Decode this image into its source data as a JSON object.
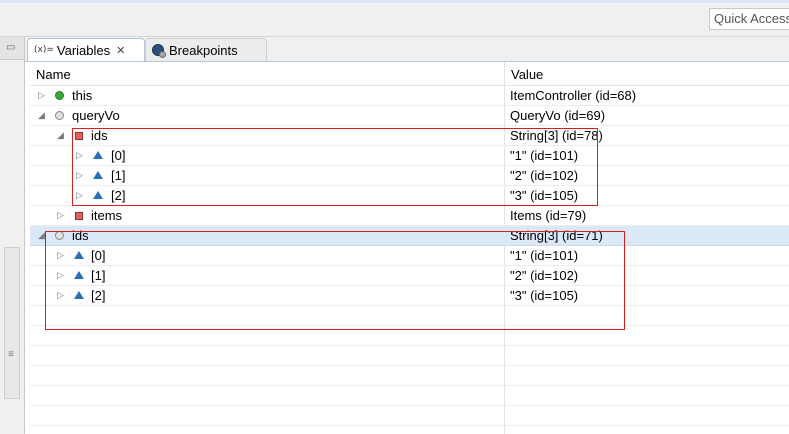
{
  "toolbar": {
    "quick_access": "Quick Access"
  },
  "tabs": [
    {
      "label": "Variables",
      "prefix": "(x)=",
      "close": "✕",
      "active": true
    },
    {
      "label": "Breakpoints",
      "active": false
    }
  ],
  "columns": {
    "name": "Name",
    "value": "Value"
  },
  "rows": [
    {
      "name": "this",
      "value": "ItemController  (id=68)",
      "icon": "green-circle",
      "expand": "collapsed",
      "depth": 0
    },
    {
      "name": "queryVo",
      "value": "QueryVo  (id=69)",
      "icon": "gray-circle",
      "expand": "expanded",
      "depth": 0
    },
    {
      "name": "ids",
      "value": "String[3]  (id=78)",
      "icon": "red-square",
      "expand": "expanded",
      "depth": 1
    },
    {
      "name": "[0]",
      "value": "\"1\" (id=101)",
      "icon": "blue-triangle",
      "expand": "collapsed",
      "depth": 2
    },
    {
      "name": "[1]",
      "value": "\"2\" (id=102)",
      "icon": "blue-triangle",
      "expand": "collapsed",
      "depth": 2
    },
    {
      "name": "[2]",
      "value": "\"3\" (id=105)",
      "icon": "blue-triangle",
      "expand": "collapsed",
      "depth": 2
    },
    {
      "name": "items",
      "value": "Items  (id=79)",
      "icon": "red-square",
      "expand": "collapsed",
      "depth": 1
    },
    {
      "name": "ids",
      "value": "String[3]  (id=71)",
      "icon": "gray-circle",
      "expand": "expanded",
      "depth": 0,
      "selected": true
    },
    {
      "name": "[0]",
      "value": "\"1\" (id=101)",
      "icon": "blue-triangle",
      "expand": "collapsed",
      "depth": 1
    },
    {
      "name": "[1]",
      "value": "\"2\" (id=102)",
      "icon": "blue-triangle",
      "expand": "collapsed",
      "depth": 1
    },
    {
      "name": "[2]",
      "value": "\"3\" (id=105)",
      "icon": "blue-triangle",
      "expand": "collapsed",
      "depth": 1
    }
  ],
  "colors": {
    "highlight_box": "#d62020",
    "selected_row": "#dbe8f8"
  }
}
